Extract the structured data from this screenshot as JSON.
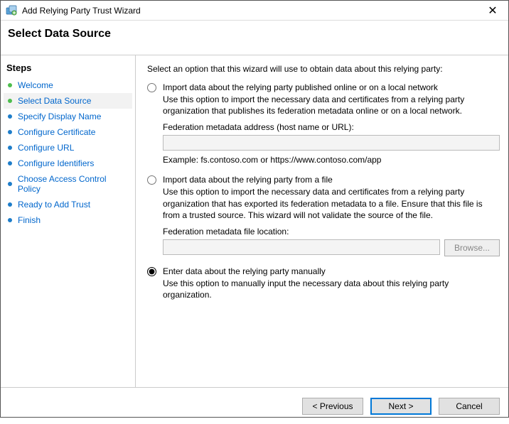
{
  "window": {
    "title": "Add Relying Party Trust Wizard",
    "close_glyph": "✕"
  },
  "header": {
    "subtitle": "Select Data Source"
  },
  "sidebar": {
    "heading": "Steps",
    "steps": [
      {
        "label": "Welcome"
      },
      {
        "label": "Select Data Source"
      },
      {
        "label": "Specify Display Name"
      },
      {
        "label": "Configure Certificate"
      },
      {
        "label": "Configure URL"
      },
      {
        "label": "Configure Identifiers"
      },
      {
        "label": "Choose Access Control Policy"
      },
      {
        "label": "Ready to Add Trust"
      },
      {
        "label": "Finish"
      }
    ]
  },
  "content": {
    "intro": "Select an option that this wizard will use to obtain data about this relying party:",
    "option_online": {
      "label": "Import data about the relying party published online or on a local network",
      "desc": "Use this option to import the necessary data and certificates from a relying party organization that publishes its federation metadata online or on a local network.",
      "field_label": "Federation metadata address (host name or URL):",
      "value": "",
      "example": "Example: fs.contoso.com or https://www.contoso.com/app"
    },
    "option_file": {
      "label": "Import data about the relying party from a file",
      "desc": "Use this option to import the necessary data and certificates from a relying party organization that has exported its federation metadata to a file. Ensure that this file is from a trusted source.  This wizard will not validate the source of the file.",
      "field_label": "Federation metadata file location:",
      "value": "",
      "browse_label": "Browse..."
    },
    "option_manual": {
      "label": "Enter data about the relying party manually",
      "desc": "Use this option to manually input the necessary data about this relying party organization."
    }
  },
  "footer": {
    "previous": "< Previous",
    "next": "Next >",
    "cancel": "Cancel"
  }
}
